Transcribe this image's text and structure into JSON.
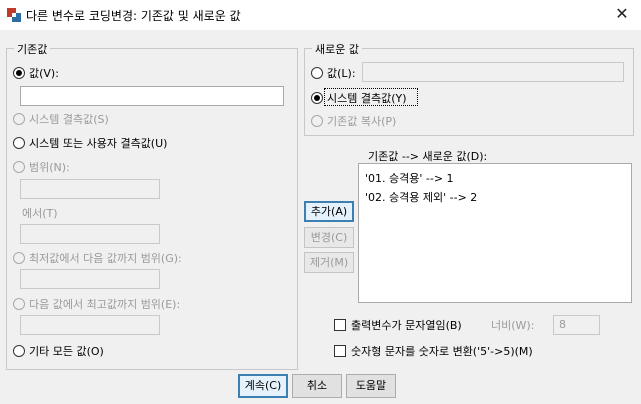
{
  "window": {
    "title": "다른 변수로 코딩변경: 기존값 및 새로운 값",
    "close": "✕"
  },
  "old_value": {
    "group_label": "기존값",
    "value_label": "값(V):",
    "system_missing_label": "시스템 결측값(S)",
    "system_or_user_missing_label": "시스템 또는 사용자 결측값(U)",
    "range_label": "범위(N):",
    "through_label": "에서(T)",
    "range_lowest_label": "최저값에서 다음 값까지 범위(G):",
    "range_highest_label": "다음 값에서 최고값까지 범위(E):",
    "all_other_label": "기타 모든 값(O)"
  },
  "new_value": {
    "group_label": "새로운 값",
    "value_label": "값(L):",
    "system_missing_label": "시스템 결측값(Y)",
    "copy_old_label": "기존값 복사(P)"
  },
  "mapping": {
    "label": "기존값 --> 새로운 값(D):",
    "items": [
      "'01. 승격용' --> 1",
      "'02. 승격용 제외' --> 2"
    ],
    "add_label": "추가(A)",
    "change_label": "변경(C)",
    "remove_label": "제거(M)"
  },
  "options": {
    "string_output_label": "출력변수가 문자열임(B)",
    "width_label": "너비(W):",
    "width_value": "8",
    "numeric_convert_label": "숫자형 문자를 숫자로 변환('5'->5)(M)"
  },
  "buttons": {
    "continue": "계속(C)",
    "cancel": "취소",
    "help": "도움말"
  }
}
